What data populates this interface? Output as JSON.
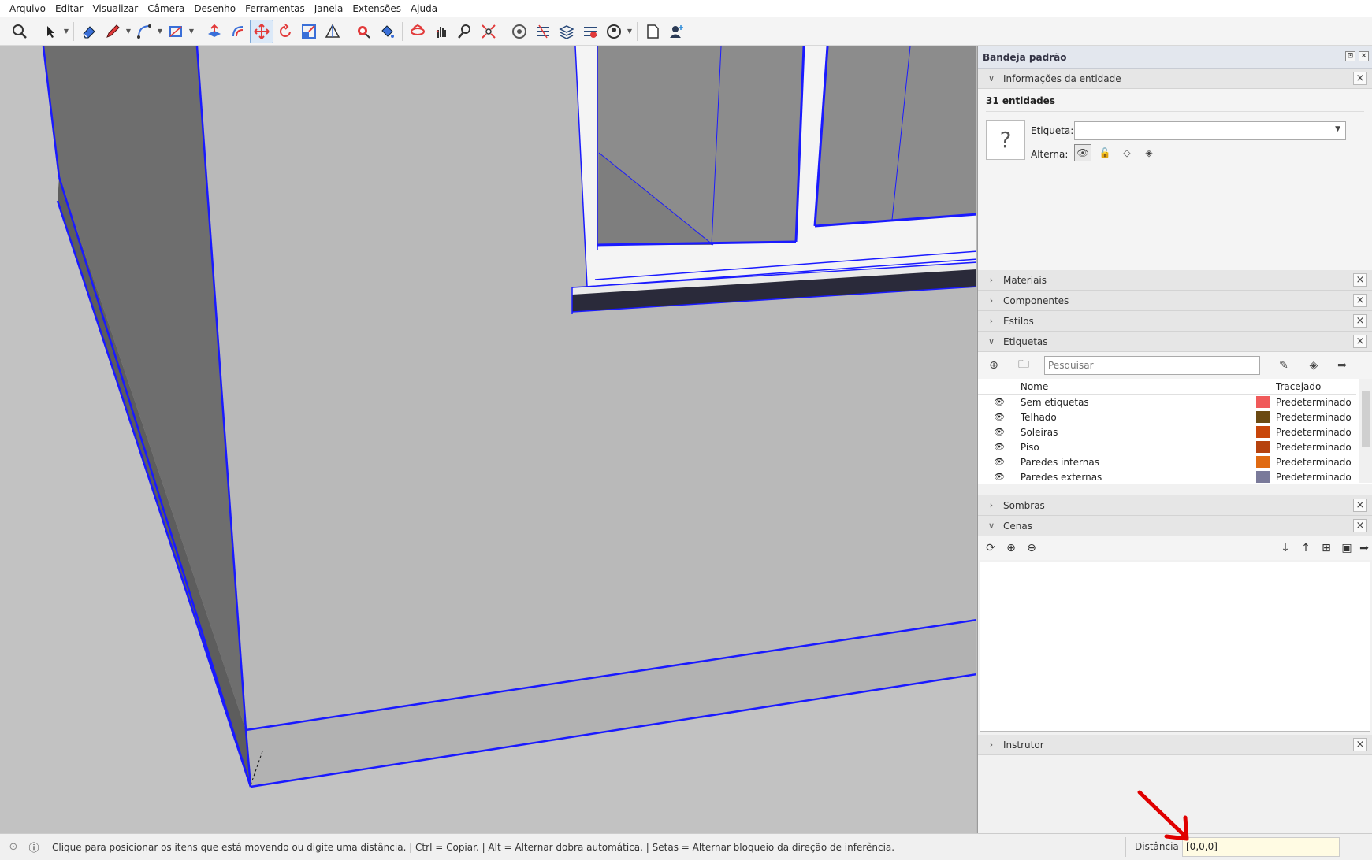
{
  "menu": [
    "Arquivo",
    "Editar",
    "Visualizar",
    "Câmera",
    "Desenho",
    "Ferramentas",
    "Janela",
    "Extensões",
    "Ajuda"
  ],
  "toolbar": {
    "tools": [
      {
        "icon": "zoom-window-icon"
      },
      {
        "icon": "select-icon"
      },
      {
        "icon": "eraser-icon"
      },
      {
        "icon": "pencil-line-icon"
      },
      {
        "icon": "arc-icon"
      },
      {
        "icon": "rectangle-icon"
      },
      {
        "icon": "push-pull-icon"
      },
      {
        "icon": "offset-icon"
      },
      {
        "icon": "move-icon",
        "active": true
      },
      {
        "icon": "rotate-icon"
      },
      {
        "icon": "scale-icon"
      },
      {
        "icon": "protractor-icon"
      },
      {
        "icon": "tape-measure-icon"
      },
      {
        "icon": "paint-bucket-icon"
      },
      {
        "icon": "orbit-icon"
      },
      {
        "icon": "pan-icon"
      },
      {
        "icon": "zoom-icon"
      },
      {
        "icon": "zoom-extents-icon"
      },
      {
        "icon": "warehouse-icon"
      },
      {
        "icon": "extension-icon"
      },
      {
        "icon": "layers-stack-icon"
      },
      {
        "icon": "extension-manager-icon"
      },
      {
        "icon": "user-profile-icon"
      },
      {
        "icon": "new-file-icon"
      },
      {
        "icon": "add-user-icon"
      }
    ]
  },
  "tray": {
    "title": "Bandeja padrão",
    "entity_info": {
      "header": "Informações da entidade",
      "count": "31 entidades",
      "tag_label": "Etiqueta:",
      "toggle_label": "Alterna:",
      "tag_value": ""
    },
    "panels_collapsed_1": [
      "Materiais",
      "Componentes",
      "Estilos"
    ],
    "tags": {
      "header": "Etiquetas",
      "search_placeholder": "Pesquisar",
      "col_name": "Nome",
      "col_dash": "Tracejado",
      "rows": [
        {
          "name": "Sem etiquetas",
          "color": "#f05a5a",
          "dash": "Predeterminado"
        },
        {
          "name": "Telhado",
          "color": "#6b4a12",
          "dash": "Predeterminado"
        },
        {
          "name": "Soleiras",
          "color": "#c8460a",
          "dash": "Predeterminado"
        },
        {
          "name": "Piso",
          "color": "#b6420e",
          "dash": "Predeterminado"
        },
        {
          "name": "Paredes internas",
          "color": "#e06a12",
          "dash": "Predeterminado"
        },
        {
          "name": "Paredes externas",
          "color": "#7a7a9a",
          "dash": "Predeterminado"
        }
      ]
    },
    "shadows": {
      "header": "Sombras"
    },
    "scenes": {
      "header": "Cenas"
    },
    "instructor": {
      "header": "Instrutor"
    }
  },
  "status": {
    "text": "Clique para posicionar os itens que está movendo ou digite uma distância. | Ctrl = Copiar. | Alt = Alternar dobra automática. | Setas = Alternar bloqueio da direção de inferência.",
    "vcb_label": "Distância",
    "vcb_value": "[0,0,0]"
  },
  "colors": {
    "selection": "#1a1aff",
    "viewport_bg": "#c2c2c2",
    "annotation": "#e00000"
  }
}
